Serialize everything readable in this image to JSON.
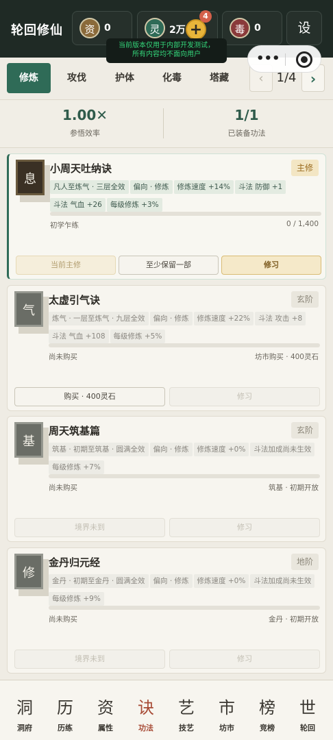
{
  "header": {
    "title": "轮回修仙",
    "resources": [
      {
        "badge": "资",
        "value": "0",
        "color": "#8a6a3a"
      },
      {
        "badge": "灵",
        "value": "2万",
        "color": "#2f6b57"
      },
      {
        "badge": "毒",
        "value": "0",
        "color": "#8a3a3a"
      }
    ],
    "plus_label": "+",
    "notification_count": "4",
    "settings_label": "设"
  },
  "toast": {
    "line1": "当前版本仅用于内部开发测试，",
    "line2": "所有内容均不面向用户"
  },
  "tabs": [
    {
      "label": "修炼",
      "active": true
    },
    {
      "label": "攻伐",
      "active": false
    },
    {
      "label": "护体",
      "active": false
    },
    {
      "label": "化毒",
      "active": false
    },
    {
      "label": "塔藏",
      "active": false
    }
  ],
  "pager": {
    "prev": "‹",
    "text": "1/4",
    "next": "›"
  },
  "stats": [
    {
      "value": "1.00✕",
      "label": "参悟效率"
    },
    {
      "value": "1/1",
      "label": "已装备功法"
    }
  ],
  "cards": [
    {
      "seal": "息",
      "name": "小周天吐纳诀",
      "grade": "主修",
      "tags": [
        "凡人至炼气 · 三层全效",
        "偏向 · 修炼",
        "修炼速度 +14%",
        "斗法 防御 +1",
        "斗法 气血 +26",
        "每级修炼 +3%"
      ],
      "progress": 0,
      "status_left": "初学乍练",
      "status_right": "0 / 1,400",
      "buttons": [
        "当前主修",
        "至少保留一部",
        "修习"
      ]
    },
    {
      "seal": "气",
      "name": "太虚引气诀",
      "grade": "玄阶",
      "tags": [
        "炼气 · 一层至炼气 · 九层全效",
        "偏向 · 修炼",
        "修炼速度 +22%",
        "斗法 攻击 +8",
        "斗法 气血 +108",
        "每级修炼 +5%"
      ],
      "status_left": "尚未购买",
      "status_right": "坊市购买 · 400灵石",
      "buttons": [
        "购买 · 400灵石",
        "修习"
      ]
    },
    {
      "seal": "基",
      "name": "周天筑基篇",
      "grade": "玄阶",
      "tags": [
        "筑基 · 初期至筑基 · 圆满全效",
        "偏向 · 修炼",
        "修炼速度 +0%",
        "斗法加成尚未生效",
        "每级修炼 +7%"
      ],
      "status_left": "尚未购买",
      "status_right": "筑基 · 初期开放",
      "buttons": [
        "境界未到",
        "修习"
      ]
    },
    {
      "seal": "修",
      "name": "金丹归元经",
      "grade": "地阶",
      "tags": [
        "金丹 · 初期至金丹 · 圆满全效",
        "偏向 · 修炼",
        "修炼速度 +0%",
        "斗法加成尚未生效",
        "每级修炼 +9%"
      ],
      "status_left": "尚未购买",
      "status_right": "金丹 · 初期开放",
      "buttons": [
        "境界未到",
        "修习"
      ]
    }
  ],
  "bottom_nav": [
    {
      "glyph": "洞",
      "label": "洞府"
    },
    {
      "glyph": "历",
      "label": "历练"
    },
    {
      "glyph": "资",
      "label": "属性"
    },
    {
      "glyph": "诀",
      "label": "功法",
      "active": true
    },
    {
      "glyph": "艺",
      "label": "技艺"
    },
    {
      "glyph": "市",
      "label": "坊市"
    },
    {
      "glyph": "榜",
      "label": "竞榜"
    },
    {
      "glyph": "世",
      "label": "轮回"
    }
  ]
}
